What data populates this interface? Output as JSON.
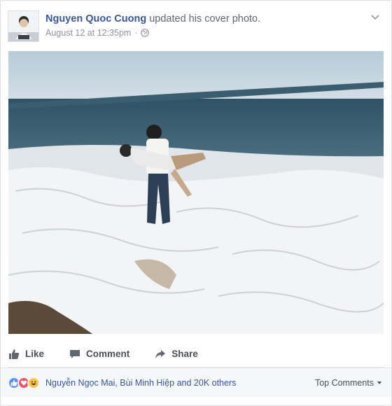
{
  "post": {
    "author": "Nguyen Quoc Cuong",
    "action": "updated his cover photo.",
    "date": "August 12 at 12:35pm",
    "separator": "·",
    "privacy_icon": "globe-icon",
    "menu_icon": "chevron-down-icon"
  },
  "photo": {
    "sky_color": "#c9d8e1",
    "sea_color": "#3f6275",
    "foam_color": "#eef1f2",
    "sand_color": "#6e5a45"
  },
  "actions": {
    "like_label": "Like",
    "comment_label": "Comment",
    "share_label": "Share"
  },
  "reactions": {
    "icons": [
      "like-reaction-icon",
      "love-reaction-icon",
      "haha-reaction-icon"
    ],
    "summary": "Nguyễn Ngọc Mai, Bùi Minh Hiệp and 20K others",
    "sort_label": "Top Comments"
  },
  "colors": {
    "link": "#365899",
    "like_blue": "#5890ff",
    "love_red": "#f25268",
    "haha_yellow": "#f7c444"
  }
}
